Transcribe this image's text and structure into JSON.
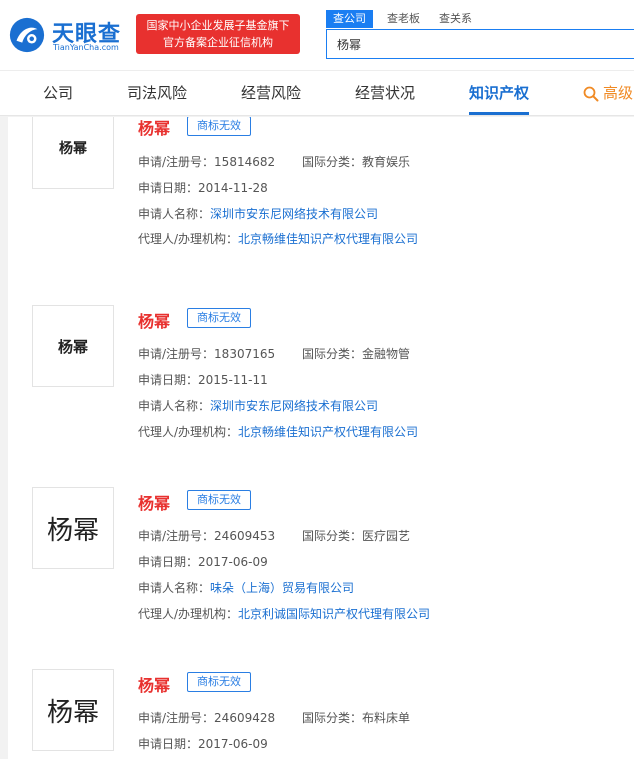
{
  "header": {
    "logo_text": "天眼查",
    "logo_sub": "TianYanCha.com",
    "banner_line1": "国家中小企业发展子基金旗下",
    "banner_line2": "官方备案企业征信机构",
    "search_tabs": [
      "查公司",
      "查老板",
      "查关系"
    ],
    "search_value": "杨幂"
  },
  "nav": {
    "items": [
      "公司",
      "司法风险",
      "经营风险",
      "经营状况",
      "知识产权"
    ],
    "active_index": 4,
    "advanced_label": "高级"
  },
  "labels": {
    "reg_no": "申请/注册号：",
    "intl_class": "国际分类：",
    "apply_date": "申请日期：",
    "applicant": "申请人名称：",
    "agent": "代理人/办理机构："
  },
  "trademarks": [
    {
      "thumb_text": "杨幂",
      "name": "杨幂",
      "status": "商标无效",
      "reg_no": "15814682",
      "intl_class": "教育娱乐",
      "apply_date": "2014-11-28",
      "applicant": "深圳市安东尼网络技术有限公司",
      "agent": "北京畅维佳知识产权代理有限公司"
    },
    {
      "thumb_text": "杨幂",
      "name": "杨幂",
      "status": "商标无效",
      "reg_no": "18307165",
      "intl_class": "金融物管",
      "apply_date": "2015-11-11",
      "applicant": "深圳市安东尼网络技术有限公司",
      "agent": "北京畅维佳知识产权代理有限公司"
    },
    {
      "thumb_text": "杨幂",
      "name": "杨幂",
      "status": "商标无效",
      "reg_no": "24609453",
      "intl_class": "医疗园艺",
      "apply_date": "2017-06-09",
      "applicant": "味朵（上海）贸易有限公司",
      "agent": "北京利诚国际知识产权代理有限公司"
    },
    {
      "thumb_text": "杨幂",
      "name": "杨幂",
      "status": "商标无效",
      "reg_no": "24609428",
      "intl_class": "布料床单",
      "apply_date": "2017-06-09"
    }
  ],
  "colors": {
    "brand_blue": "#1a6fd1",
    "accent_red": "#e8312f",
    "advanced_orange": "#f08a24"
  }
}
